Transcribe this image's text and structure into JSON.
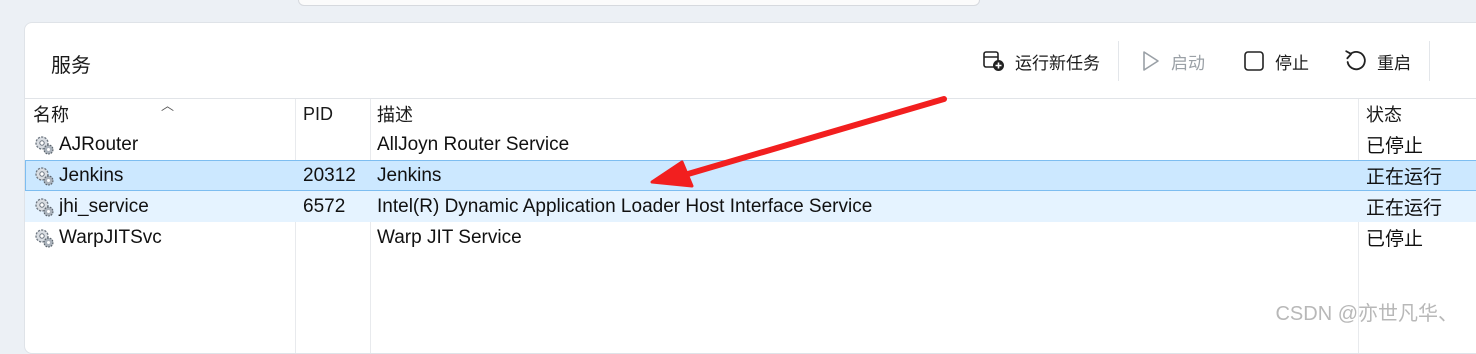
{
  "page": {
    "title": "服务"
  },
  "toolbar": {
    "run_new_task": "运行新任务",
    "start": "启动",
    "stop": "停止",
    "restart": "重启"
  },
  "columns": {
    "name": "名称",
    "pid": "PID",
    "description": "描述",
    "status": "状态"
  },
  "services": [
    {
      "name": "AJRouter",
      "pid": "",
      "description": "AllJoyn Router Service",
      "status": "已停止"
    },
    {
      "name": "Jenkins",
      "pid": "20312",
      "description": "Jenkins",
      "status": "正在运行"
    },
    {
      "name": "jhi_service",
      "pid": "6572",
      "description": "Intel(R) Dynamic Application Loader Host Interface Service",
      "status": "正在运行"
    },
    {
      "name": "WarpJITSvc",
      "pid": "",
      "description": "Warp JIT Service",
      "status": "已停止"
    }
  ],
  "watermark": "CSDN @亦世凡华、",
  "colors": {
    "selected_row": "#cce8ff",
    "hover_row": "#e5f3ff",
    "arrow": "#f21f1f"
  },
  "icons": {
    "run_new_task": "new-task-icon",
    "start": "play-icon",
    "stop": "stop-square-icon",
    "restart": "restart-icon",
    "service": "gear-service-icon"
  }
}
